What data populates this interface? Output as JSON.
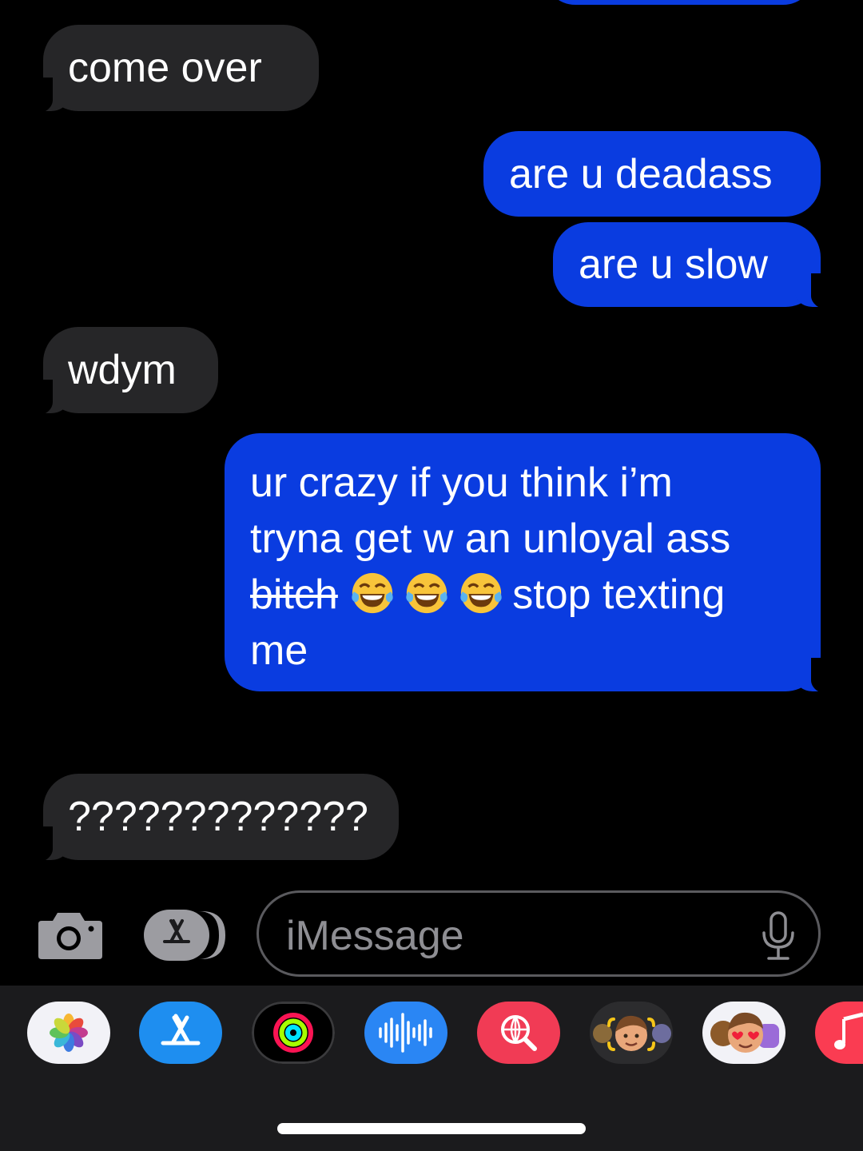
{
  "messages": [
    {
      "side": "received",
      "text": "come over"
    },
    {
      "side": "sent",
      "text": "are u deadass"
    },
    {
      "side": "sent",
      "text": "are u slow"
    },
    {
      "side": "received",
      "text": "wdym"
    },
    {
      "side": "sent",
      "line1": "ur crazy if you think i’m",
      "line2": "tryna get w an unloyal ass",
      "struck_word": "bitch",
      "after_emoji": "stop texting",
      "line4": "me",
      "emoji": [
        "face-with-tears-of-joy",
        "face-with-tears-of-joy",
        "face-with-tears-of-joy"
      ]
    },
    {
      "side": "received",
      "text": "?????????????"
    }
  ],
  "composer": {
    "placeholder": "iMessage",
    "icons": [
      "camera-icon",
      "app-store-icon",
      "microphone-icon"
    ]
  },
  "app_drawer": {
    "apps": [
      "photos",
      "app-store",
      "activity",
      "audio-message",
      "web-search",
      "memoji-stickers",
      "animoji",
      "music"
    ]
  },
  "colors": {
    "background": "#000000",
    "received_bubble": "#262628",
    "sent_bubble": "#0a3ce0",
    "text": "#ffffff",
    "placeholder": "#8e8e93",
    "drawer": "#1b1b1d"
  }
}
